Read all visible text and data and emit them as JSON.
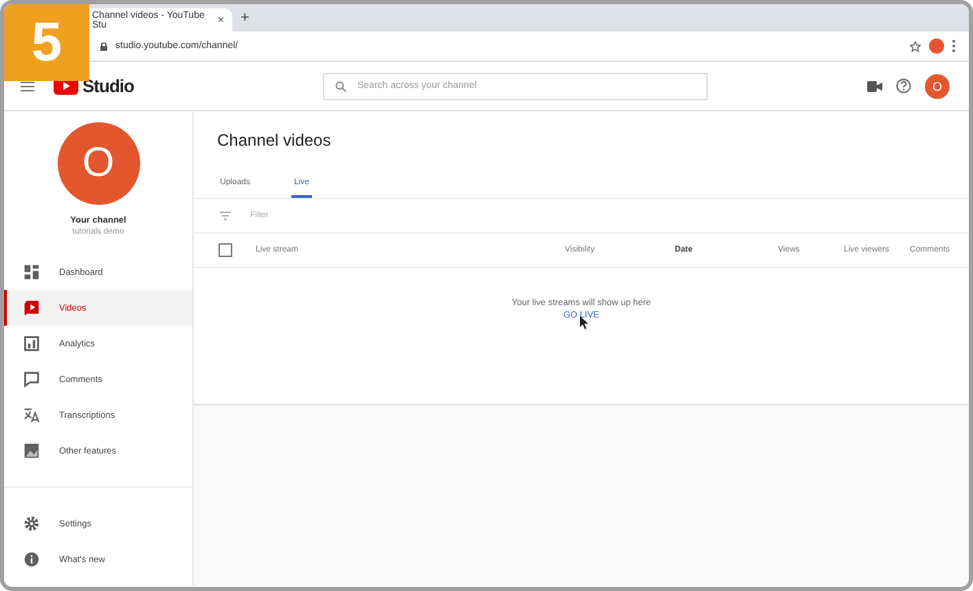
{
  "step_badge": "5",
  "browser": {
    "tab_title": "Channel videos - YouTube Stu",
    "new_tab": "+",
    "tab_close": "×",
    "url": "studio.youtube.com/channel/"
  },
  "header": {
    "logo": "Studio",
    "search_placeholder": "Search across your channel",
    "avatar": "O"
  },
  "sidebar": {
    "avatar": "O",
    "channel_name": "Your channel",
    "channel_handle": "tutorials demo",
    "items": [
      {
        "label": "Dashboard",
        "kind": "dashboard",
        "selected": false
      },
      {
        "label": "Videos",
        "kind": "videos",
        "selected": true
      },
      {
        "label": "Analytics",
        "kind": "analytics",
        "selected": false
      },
      {
        "label": "Comments",
        "kind": "comments",
        "selected": false
      },
      {
        "label": "Transcriptions",
        "kind": "translate",
        "selected": false
      },
      {
        "label": "Other features",
        "kind": "features",
        "selected": false
      }
    ],
    "footer_items": [
      {
        "label": "Settings",
        "kind": "settings",
        "selected": false
      },
      {
        "label": "What's new",
        "kind": "info",
        "selected": false
      }
    ]
  },
  "main": {
    "title": "Channel videos",
    "tabs": [
      {
        "label": "Uploads",
        "selected": false
      },
      {
        "label": "Live",
        "selected": true
      }
    ],
    "filter_placeholder": "Filter",
    "select_all_checked": false,
    "columns": [
      "Live stream",
      "Visibility",
      "Date",
      "Views",
      "Live viewers",
      "Comments"
    ],
    "empty_message": "Your live streams will show up here",
    "empty_link": "GO LIVE"
  }
}
